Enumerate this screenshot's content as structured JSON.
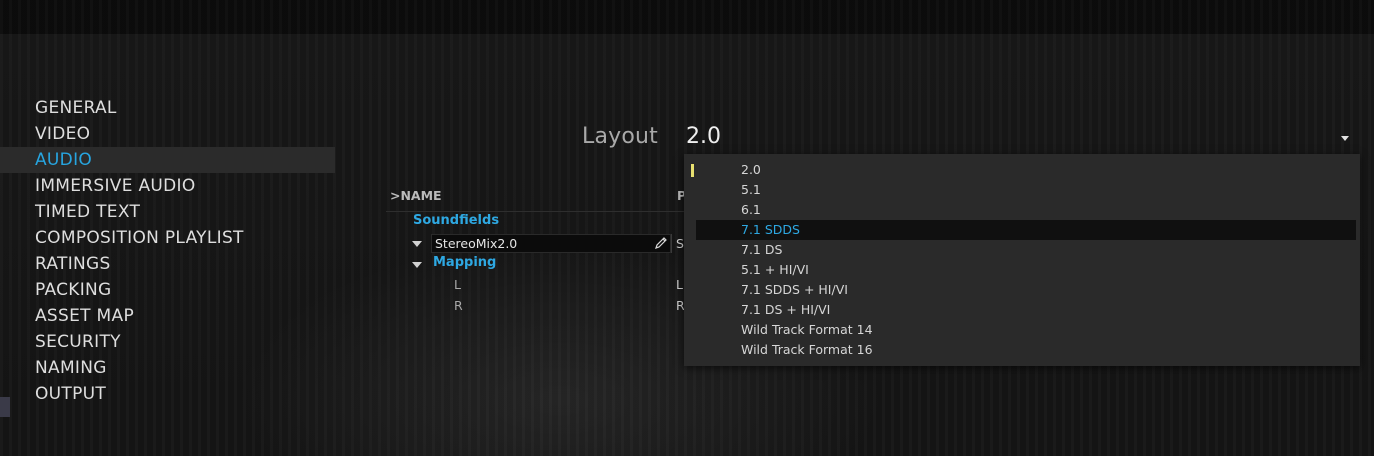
{
  "sidebar": {
    "items": [
      {
        "label": "GENERAL"
      },
      {
        "label": "VIDEO"
      },
      {
        "label": "AUDIO",
        "active": true
      },
      {
        "label": "IMMERSIVE AUDIO"
      },
      {
        "label": "TIMED TEXT"
      },
      {
        "label": "COMPOSITION PLAYLIST"
      },
      {
        "label": "RATINGS"
      },
      {
        "label": "PACKING"
      },
      {
        "label": "ASSET MAP"
      },
      {
        "label": "SECURITY"
      },
      {
        "label": "NAMING"
      },
      {
        "label": "OUTPUT"
      }
    ]
  },
  "layout": {
    "label": "Layout",
    "value": "2.0",
    "options": [
      "2.0",
      "5.1",
      "6.1",
      "7.1 SDDS",
      "7.1 DS",
      "5.1 + HI/VI",
      "7.1 SDDS + HI/VI",
      "7.1 DS + HI/VI",
      "Wild Track Format 14",
      "Wild Track Format 16"
    ],
    "highlighted": "7.1 SDDS"
  },
  "table": {
    "header_name": ">NAME",
    "header_p": "P",
    "soundfields_label": "Soundfields",
    "soundfield_name": "StereoMix2.0",
    "soundfield_p": "S",
    "mapping_label": "Mapping",
    "channels": [
      {
        "name": "L",
        "p": "L"
      },
      {
        "name": "R",
        "p": "R"
      }
    ]
  },
  "colors": {
    "accent": "#27a5e0",
    "background": "#111112",
    "dropdown": "#2a2a2a"
  },
  "icons": [
    "pencil-icon",
    "chevron-down-icon",
    "expand-triangle-icon"
  ]
}
